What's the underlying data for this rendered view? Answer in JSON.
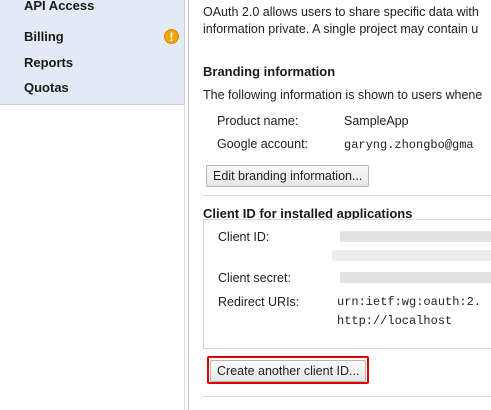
{
  "sidebar": {
    "items": [
      {
        "label": "API Access"
      },
      {
        "label": "Billing",
        "has_warning": true
      },
      {
        "label": "Reports"
      },
      {
        "label": "Quotas"
      }
    ],
    "warning_glyph": "!"
  },
  "main": {
    "intro_line1": "OAuth 2.0 allows users to share specific data with",
    "intro_line2": "information private. A single project may contain u",
    "branding": {
      "title": "Branding information",
      "description": "The following information is shown to users whene",
      "product_name_label": "Product name:",
      "product_name_value": "SampleApp",
      "google_account_label": "Google account:",
      "google_account_value": "garyng.zhongbo@gma",
      "edit_button_label": "Edit branding information..."
    },
    "client": {
      "title": "Client ID for installed applications",
      "client_id_label": "Client ID:",
      "client_secret_label": "Client secret:",
      "redirect_label": "Redirect URIs:",
      "redirect_values": [
        "urn:ietf:wg:oauth:2.",
        "http://localhost"
      ],
      "create_button_label": "Create another client ID..."
    }
  },
  "colors": {
    "sidebar_bg": "#e4e9f6",
    "warning": "#f0a60e",
    "highlight_border": "#e00000"
  }
}
